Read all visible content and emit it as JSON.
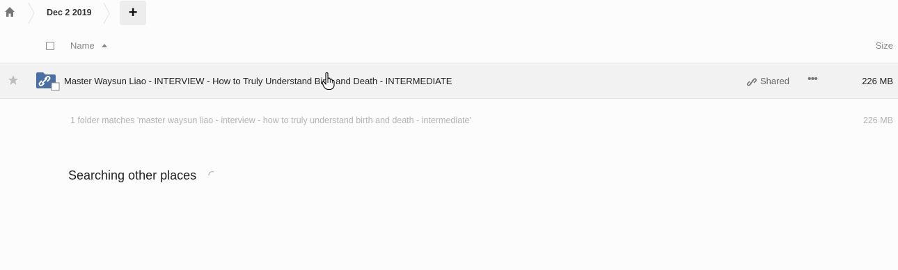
{
  "breadcrumb": {
    "home_icon": "home-icon",
    "folder": "Dec 2 2019",
    "add_label": "+"
  },
  "table_header": {
    "name_label": "Name",
    "size_label": "Size",
    "sort": "ascending"
  },
  "files": [
    {
      "name": "Master Waysun Liao - INTERVIEW - How to Truly Understand Birth and Death - INTERMEDIATE",
      "type": "shared-folder",
      "shared_label": "Shared",
      "size": "226 MB",
      "favorite": false
    }
  ],
  "summary": {
    "text": "1 folder matches 'master waysun liao - interview - how to truly understand birth and death - intermediate'",
    "size": "226 MB"
  },
  "search_status": {
    "label": "Searching other places"
  },
  "colors": {
    "folder": "#4a6fa5",
    "row_hover": "#f2f2f2"
  }
}
